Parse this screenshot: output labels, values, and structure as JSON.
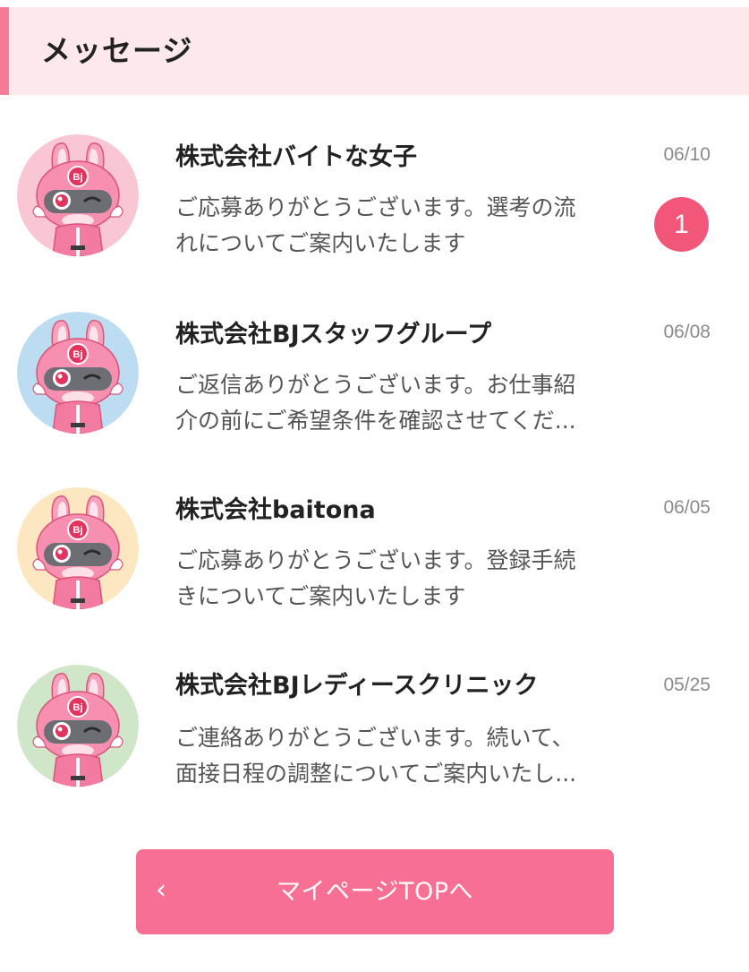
{
  "header": {
    "title": "メッセージ"
  },
  "messages": [
    {
      "company": "株式会社バイトな女子",
      "preview_line1": "ご応募ありがとうございます。選考の流",
      "preview_line2": "れについてご案内いたします",
      "date": "06/10",
      "unread": "1",
      "avatar_bg": "#f9c6d4"
    },
    {
      "company": "株式会社BJスタッフグループ",
      "preview_line1": "ご返信ありがとうございます。お仕事紹",
      "preview_line2": "介の前にご希望条件を確認させてくだ...",
      "date": "06/08",
      "avatar_bg": "#bcdcf2"
    },
    {
      "company": "株式会社baitona",
      "preview_line1": "ご応募ありがとうございます。登録手続",
      "preview_line2": "きについてご案内いたします",
      "date": "06/05",
      "avatar_bg": "#fde7c1"
    },
    {
      "company": "株式会社BJレディースクリニック",
      "preview_line1": "ご連絡ありがとうございます。続いて、",
      "preview_line2": "面接日程の調整についてご案内いたし...",
      "date": "05/25",
      "avatar_bg": "#cfe7c8"
    }
  ],
  "footer_button": {
    "chevron": "‹",
    "label": "マイページTOPへ"
  },
  "icons": {
    "avatar": "bj-mascot-avatar-icon",
    "back": "chevron-left-icon"
  },
  "colors": {
    "accent": "#f57c98",
    "header_bg": "#fde8ec",
    "badge": "#f2577a",
    "button": "#f76f93"
  }
}
